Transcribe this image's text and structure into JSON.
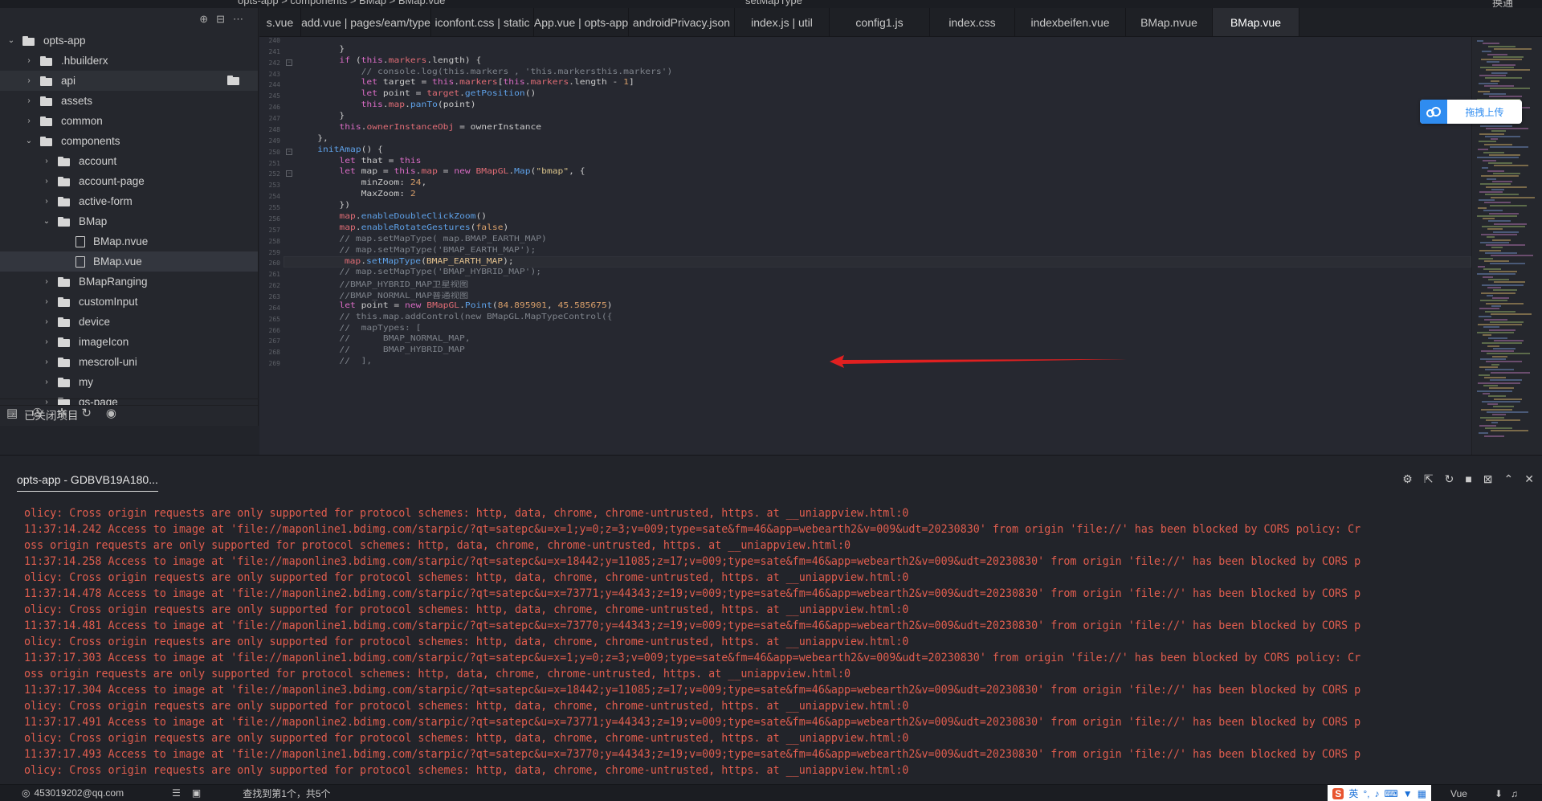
{
  "topbar": {
    "search_value": "setMapType",
    "replace_label": "换通",
    "breadcrumb": "opts-app > components > BMap > BMap.vue"
  },
  "sidebar": {
    "items": [
      {
        "label": "opts-app",
        "level": 0,
        "type": "folder",
        "expanded": true
      },
      {
        "label": ".hbuilderx",
        "level": 1,
        "type": "folder",
        "expanded": false
      },
      {
        "label": "api",
        "level": 1,
        "type": "folder",
        "expanded": false
      },
      {
        "label": "assets",
        "level": 1,
        "type": "folder",
        "expanded": false
      },
      {
        "label": "common",
        "level": 1,
        "type": "folder",
        "expanded": false
      },
      {
        "label": "components",
        "level": 1,
        "type": "folder",
        "expanded": true
      },
      {
        "label": "account",
        "level": 2,
        "type": "folder",
        "expanded": false
      },
      {
        "label": "account-page",
        "level": 2,
        "type": "folder",
        "expanded": false
      },
      {
        "label": "active-form",
        "level": 2,
        "type": "folder",
        "expanded": false
      },
      {
        "label": "BMap",
        "level": 2,
        "type": "folder",
        "expanded": true
      },
      {
        "label": "BMap.nvue",
        "level": 3,
        "type": "file"
      },
      {
        "label": "BMap.vue",
        "level": 3,
        "type": "file"
      },
      {
        "label": "BMapRanging",
        "level": 2,
        "type": "folder",
        "expanded": false
      },
      {
        "label": "customInput",
        "level": 2,
        "type": "folder",
        "expanded": false
      },
      {
        "label": "device",
        "level": 2,
        "type": "folder",
        "expanded": false
      },
      {
        "label": "imageIcon",
        "level": 2,
        "type": "folder",
        "expanded": false
      },
      {
        "label": "mescroll-uni",
        "level": 2,
        "type": "folder",
        "expanded": false
      },
      {
        "label": "my",
        "level": 2,
        "type": "folder",
        "expanded": false
      },
      {
        "label": "qs-page",
        "level": 2,
        "type": "folder",
        "expanded": false
      }
    ],
    "closed_projects": "已关闭项目"
  },
  "tabs": [
    {
      "label": "s.vue",
      "width": 52
    },
    {
      "label": "add.vue | pages/eam/type",
      "width": 162
    },
    {
      "label": "iconfont.css | static",
      "width": 128
    },
    {
      "label": "App.vue | opts-app",
      "width": 118
    },
    {
      "label": "androidPrivacy.json",
      "width": 132
    },
    {
      "label": "index.js | util",
      "width": 118
    },
    {
      "label": "config1.js",
      "width": 125
    },
    {
      "label": "index.css",
      "width": 106
    },
    {
      "label": "indexbeifen.vue",
      "width": 138
    },
    {
      "label": "BMap.nvue",
      "width": 108
    },
    {
      "label": "BMap.vue",
      "width": 108,
      "active": true
    }
  ],
  "editor": {
    "line_numbers": [
      "240",
      "241",
      "242",
      "243",
      "244",
      "245",
      "246",
      "247",
      "248",
      "249",
      "250",
      "251",
      "252",
      "253",
      "254",
      "255",
      "256",
      "257",
      "258",
      "259",
      "260",
      "261",
      "262",
      "263",
      "264",
      "265",
      "266",
      "267",
      "268",
      "269"
    ],
    "current_line": "260"
  },
  "upload": {
    "label": "拖拽上传"
  },
  "console": {
    "tab_label": "opts-app - GDBVB19A180...",
    "lines": [
      "olicy: Cross origin requests are only supported for protocol schemes: http, data, chrome, chrome-untrusted, https. at __uniappview.html:0",
      "11:37:14.242 Access to image at 'file://maponline1.bdimg.com/starpic/?qt=satepc&u=x=1;y=0;z=3;v=009;type=sate&fm=46&app=webearth2&v=009&udt=20230830' from origin 'file://' has been blocked by CORS policy: Cr",
      "oss origin requests are only supported for protocol schemes: http, data, chrome, chrome-untrusted, https. at __uniappview.html:0",
      "11:37:14.258 Access to image at 'file://maponline3.bdimg.com/starpic/?qt=satepc&u=x=18442;y=11085;z=17;v=009;type=sate&fm=46&app=webearth2&v=009&udt=20230830' from origin 'file://' has been blocked by CORS p",
      "olicy: Cross origin requests are only supported for protocol schemes: http, data, chrome, chrome-untrusted, https. at __uniappview.html:0",
      "11:37:14.478 Access to image at 'file://maponline2.bdimg.com/starpic/?qt=satepc&u=x=73771;y=44343;z=19;v=009;type=sate&fm=46&app=webearth2&v=009&udt=20230830' from origin 'file://' has been blocked by CORS p",
      "olicy: Cross origin requests are only supported for protocol schemes: http, data, chrome, chrome-untrusted, https. at __uniappview.html:0",
      "11:37:14.481 Access to image at 'file://maponline1.bdimg.com/starpic/?qt=satepc&u=x=73770;y=44343;z=19;v=009;type=sate&fm=46&app=webearth2&v=009&udt=20230830' from origin 'file://' has been blocked by CORS p",
      "olicy: Cross origin requests are only supported for protocol schemes: http, data, chrome, chrome-untrusted, https. at __uniappview.html:0",
      "11:37:17.303 Access to image at 'file://maponline1.bdimg.com/starpic/?qt=satepc&u=x=1;y=0;z=3;v=009;type=sate&fm=46&app=webearth2&v=009&udt=20230830' from origin 'file://' has been blocked by CORS policy: Cr",
      "oss origin requests are only supported for protocol schemes: http, data, chrome, chrome-untrusted, https. at __uniappview.html:0",
      "11:37:17.304 Access to image at 'file://maponline3.bdimg.com/starpic/?qt=satepc&u=x=18442;y=11085;z=17;v=009;type=sate&fm=46&app=webearth2&v=009&udt=20230830' from origin 'file://' has been blocked by CORS p",
      "olicy: Cross origin requests are only supported for protocol schemes: http, data, chrome, chrome-untrusted, https. at __uniappview.html:0",
      "11:37:17.491 Access to image at 'file://maponline2.bdimg.com/starpic/?qt=satepc&u=x=73771;y=44343;z=19;v=009;type=sate&fm=46&app=webearth2&v=009&udt=20230830' from origin 'file://' has been blocked by CORS p",
      "olicy: Cross origin requests are only supported for protocol schemes: http, data, chrome, chrome-untrusted, https. at __uniappview.html:0",
      "11:37:17.493 Access to image at 'file://maponline1.bdimg.com/starpic/?qt=satepc&u=x=73770;y=44343;z=19;v=009;type=sate&fm=46&app=webearth2&v=009&udt=20230830' from origin 'file://' has been blocked by CORS p",
      "olicy: Cross origin requests are only supported for protocol schemes: http, data, chrome, chrome-untrusted, https. at __uniappview.html:0"
    ]
  },
  "status": {
    "user": "453019202@qq.com",
    "find_result": "查找到第1个，共5个",
    "lang": "Vue",
    "ime": "英"
  },
  "colors": {
    "log_error": "#e05d4e",
    "accent": "#2f8cf0"
  }
}
